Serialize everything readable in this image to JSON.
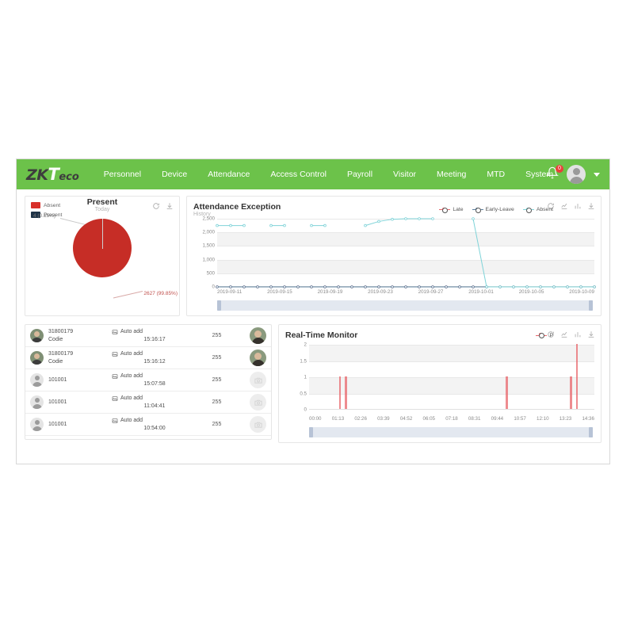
{
  "brand": {
    "logo_zk": "ZK",
    "logo_t": "T",
    "logo_eco": "eco",
    "nav_bg": "#6cc24a"
  },
  "nav": {
    "items": [
      {
        "label": "Personnel"
      },
      {
        "label": "Device"
      },
      {
        "label": "Attendance"
      },
      {
        "label": "Access Control"
      },
      {
        "label": "Payroll"
      },
      {
        "label": "Visitor"
      },
      {
        "label": "Meeting"
      },
      {
        "label": "MTD"
      },
      {
        "label": "System"
      }
    ],
    "notification_count": "0",
    "bell_icon": "bell-icon",
    "avatar_icon": "user-avatar-icon",
    "caret_icon": "chevron-down-icon"
  },
  "present_card": {
    "title": "Present",
    "subtitle": "Today",
    "legend": [
      {
        "label": "Absent",
        "color": "#d8302a"
      },
      {
        "label": "Present",
        "color": "#1f3448"
      }
    ],
    "label_present": "4 (0.15%)",
    "label_absent": "2627 (99.85%)",
    "icons": [
      "refresh-icon",
      "download-icon"
    ]
  },
  "exception_card": {
    "title": "Attendance Exception",
    "subtitle": "History",
    "legend": [
      {
        "label": "Late",
        "color": "#e8666b"
      },
      {
        "label": "Early-Leave",
        "color": "#5b7f9e"
      },
      {
        "label": "Absent",
        "color": "#7fd3d8"
      }
    ],
    "icons": [
      "refresh-icon",
      "line-chart-icon",
      "bar-chart-icon",
      "download-icon"
    ]
  },
  "monitor_card": {
    "title": "Real-Time Monitor",
    "legend": [
      {
        "label": "P",
        "color": "#e8666b"
      }
    ],
    "icons": [
      "refresh-icon",
      "line-chart-icon",
      "bar-chart-icon",
      "download-icon"
    ]
  },
  "records": {
    "rows": [
      {
        "id": "31800179",
        "name": "Codie",
        "event": "Auto add",
        "time": "15:16:17",
        "value": "255",
        "avatar": "photo",
        "thumb": "photo"
      },
      {
        "id": "31800179",
        "name": "Codie",
        "event": "Auto add",
        "time": "15:16:12",
        "value": "255",
        "avatar": "photo",
        "thumb": "photo"
      },
      {
        "id": "101001",
        "name": "",
        "event": "Auto add",
        "time": "15:07:58",
        "value": "255",
        "avatar": "person",
        "thumb": "camera"
      },
      {
        "id": "101001",
        "name": "",
        "event": "Auto add",
        "time": "11:04:41",
        "value": "255",
        "avatar": "person",
        "thumb": "camera"
      },
      {
        "id": "101001",
        "name": "",
        "event": "Auto add",
        "time": "10:54:00",
        "value": "255",
        "avatar": "person",
        "thumb": "camera"
      }
    ]
  },
  "chart_data": [
    {
      "type": "line",
      "title": "Attendance Exception",
      "subtitle": "History",
      "xlabel": "",
      "ylabel": "",
      "ylim": [
        0,
        2500
      ],
      "yticks": [
        "0",
        "500",
        "1,000",
        "1,500",
        "2,000",
        "2,500"
      ],
      "grid": true,
      "legend_position": "top-center",
      "x": [
        "2019-09-11",
        "2019-09-15",
        "2019-09-19",
        "2019-09-23",
        "2019-09-27",
        "2019-10-01",
        "2019-10-05",
        "2019-10-09"
      ],
      "x_all": [
        "2019-09-11",
        "2019-09-12",
        "2019-09-13",
        "2019-09-14",
        "2019-09-15",
        "2019-09-16",
        "2019-09-17",
        "2019-09-18",
        "2019-09-19",
        "2019-09-20",
        "2019-09-21",
        "2019-09-22",
        "2019-09-23",
        "2019-09-24",
        "2019-09-25",
        "2019-09-26",
        "2019-09-27",
        "2019-09-28",
        "2019-09-29",
        "2019-09-30",
        "2019-10-01",
        "2019-10-02",
        "2019-10-03",
        "2019-10-04",
        "2019-10-05",
        "2019-10-06",
        "2019-10-07",
        "2019-10-08",
        "2019-10-09"
      ],
      "series": [
        {
          "name": "Late",
          "color": "#e8666b",
          "values": [
            0,
            0,
            0,
            0,
            0,
            0,
            0,
            0,
            0,
            0,
            0,
            0,
            0,
            0,
            0,
            0,
            0,
            0,
            0,
            0,
            0,
            0,
            0,
            0,
            0,
            0,
            0,
            0,
            0
          ]
        },
        {
          "name": "Early-Leave",
          "color": "#5b7f9e",
          "values": [
            0,
            0,
            0,
            0,
            0,
            0,
            0,
            0,
            0,
            0,
            0,
            0,
            0,
            0,
            0,
            0,
            0,
            0,
            0,
            0,
            0,
            0,
            0,
            0,
            0,
            0,
            0,
            0,
            0
          ]
        },
        {
          "name": "Absent",
          "color": "#7fd3d8",
          "values": [
            2250,
            2250,
            2250,
            null,
            2250,
            2250,
            null,
            2250,
            2250,
            null,
            null,
            2250,
            2400,
            2480,
            2500,
            2500,
            2500,
            null,
            null,
            2500,
            0,
            0,
            0,
            0,
            0,
            0,
            0,
            0,
            0
          ]
        }
      ]
    },
    {
      "type": "bar",
      "title": "Real-Time Monitor",
      "xlabel": "",
      "ylabel": "",
      "ylim": [
        0,
        2
      ],
      "yticks": [
        "0",
        "0.5",
        "1",
        "1.5",
        "2"
      ],
      "grid": true,
      "legend_position": "top-center",
      "categories": [
        "00:00",
        "01:13",
        "02:26",
        "03:39",
        "04:52",
        "06:05",
        "07:18",
        "08:31",
        "09:44",
        "10:57",
        "12:10",
        "13:23",
        "14:36"
      ],
      "series": [
        {
          "name": "P",
          "color": "#e8666b",
          "bars": [
            {
              "x_pct": 10.5,
              "value": 1
            },
            {
              "x_pct": 12.6,
              "value": 1
            },
            {
              "x_pct": 69.0,
              "value": 1
            },
            {
              "x_pct": 91.5,
              "value": 1
            },
            {
              "x_pct": 93.5,
              "value": 2
            }
          ]
        }
      ]
    }
  ]
}
